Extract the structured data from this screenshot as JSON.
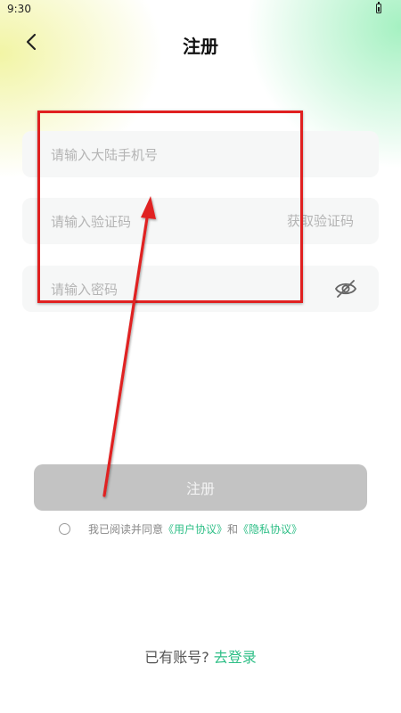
{
  "status_bar": {
    "time": "9:30",
    "battery_icon": "battery-icon"
  },
  "header": {
    "title": "注册",
    "back_icon": "chevron-left-icon"
  },
  "form": {
    "phone": {
      "placeholder": "请输入大陆手机号",
      "value": ""
    },
    "code": {
      "placeholder": "请输入验证码",
      "value": "",
      "get_code_label": "获取验证码"
    },
    "password": {
      "placeholder": "请输入密码",
      "value": "",
      "visibility_icon": "eye-off-icon"
    }
  },
  "register_button": {
    "label": "注册"
  },
  "agreement": {
    "prefix": "我已阅读并同意",
    "user_agreement": "《用户协议》",
    "and": "和",
    "privacy_policy": "《隐私协议》",
    "checked": false
  },
  "login_prompt": {
    "text": "已有账号?",
    "link": "去登录"
  },
  "colors": {
    "accent": "#2fbf87",
    "button_disabled": "#c3c3c3",
    "field_bg": "#f6f7f7",
    "annotation": "#e02020"
  }
}
